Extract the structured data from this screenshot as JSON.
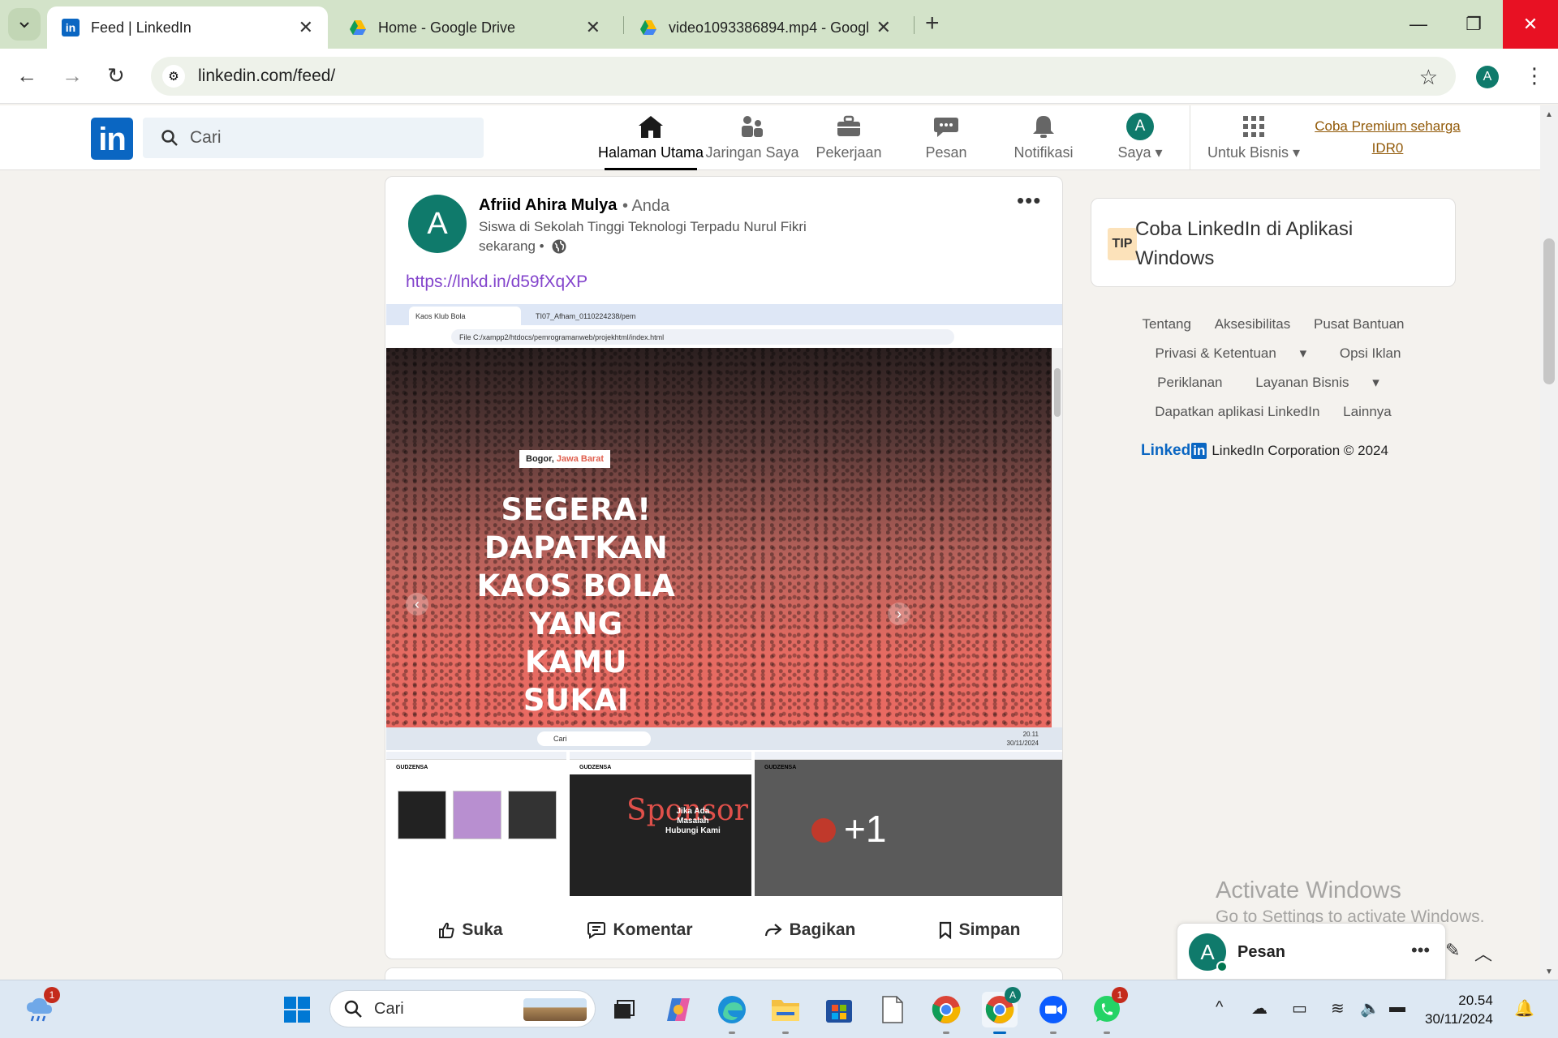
{
  "browser": {
    "tabs": [
      {
        "label": "Feed | LinkedIn",
        "active": true
      },
      {
        "label": "Home - Google Drive",
        "active": false
      },
      {
        "label": "video1093386894.mp4 - Google",
        "active": false
      }
    ],
    "url": "linkedin.com/feed/",
    "profile_initial": "A"
  },
  "linkedin": {
    "search_placeholder": "Cari",
    "nav": [
      {
        "label": "Halaman Utama",
        "icon": "home-icon",
        "active": true
      },
      {
        "label": "Jaringan Saya",
        "icon": "network-icon"
      },
      {
        "label": "Pekerjaan",
        "icon": "briefcase-icon"
      },
      {
        "label": "Pesan",
        "icon": "messaging-icon"
      },
      {
        "label": "Notifikasi",
        "icon": "bell-icon"
      },
      {
        "label": "Saya",
        "icon": "me-avatar"
      },
      {
        "label": "Untuk Bisnis",
        "icon": "grid-icon"
      }
    ],
    "me_initial": "A",
    "premium_line1": "Coba Premium seharga",
    "premium_line2": "IDR0",
    "accent": "#0a66c2"
  },
  "post": {
    "avatar_initial": "A",
    "author": "Afriid Ahira Mulya",
    "relation": "• Anda",
    "headline": "Siswa di Sekolah Tinggi Teknologi Terpadu Nurul Fikri",
    "time": "sekarang •",
    "link": "https://lnkd.in/d59fXqXP",
    "media": {
      "ss_tab1": "Kaos Klub Bola",
      "ss_tab2": "TI07_Afham_0110224238/pem",
      "ss_url": "File   C:/xampp2/htdocs/pemrogramanweb/projekhtml/index.html",
      "location_prefix": "Bogor,",
      "location_highlight": "Jawa Barat",
      "hero_lines": [
        "SEGERA!",
        "DAPATKAN",
        "KAOS BOLA",
        "YANG",
        "KAMU",
        "SUKAI"
      ],
      "ss_search": "Cari",
      "ss_time": "20.11",
      "ss_date": "30/11/2024",
      "brand": "GUDZENSA",
      "sponsor_text": "Sponsor",
      "sponsor_sub1": "Jika Ada",
      "sponsor_sub2": "Masalah",
      "sponsor_sub3": "Hubungi Kami",
      "more_count": "+1"
    },
    "actions": [
      {
        "label": "Suka",
        "icon": "like-icon"
      },
      {
        "label": "Komentar",
        "icon": "comment-icon"
      },
      {
        "label": "Bagikan",
        "icon": "share-icon"
      },
      {
        "label": "Simpan",
        "icon": "bookmark-icon"
      }
    ]
  },
  "right_rail": {
    "tip_badge": "TIP",
    "tip_title": "Coba LinkedIn di Aplikasi Windows",
    "footer_links": [
      "Tentang",
      "Aksesibilitas",
      "Pusat Bantuan",
      "Privasi & Ketentuan",
      "Opsi Iklan",
      "Periklanan",
      "Layanan Bisnis",
      "Dapatkan aplikasi LinkedIn",
      "Lainnya"
    ],
    "logo_text": "Linked",
    "logo_in": "in",
    "copyright": "LinkedIn Corporation © 2024"
  },
  "activate_windows": {
    "line1": "Activate Windows",
    "line2": "Go to Settings to activate Windows."
  },
  "messaging": {
    "avatar_initial": "A",
    "label": "Pesan"
  },
  "taskbar": {
    "weather_badge": "1",
    "search_placeholder": "Cari",
    "whatsapp_badge": "1",
    "chrome_profile_badge": "A",
    "time": "20.54",
    "date": "30/11/2024"
  }
}
